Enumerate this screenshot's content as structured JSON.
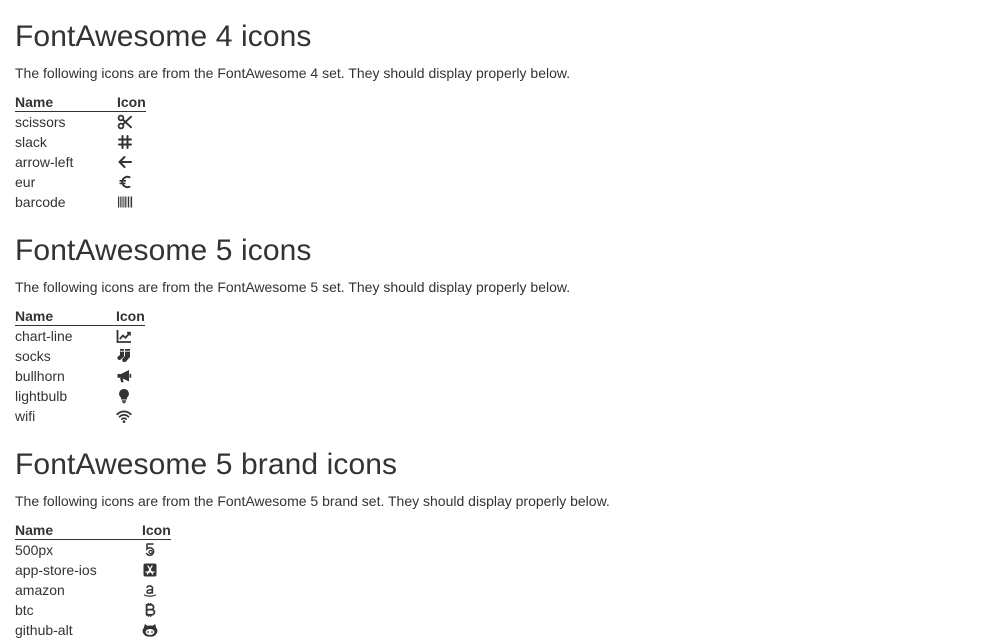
{
  "sections": [
    {
      "title": "FontAwesome 4 icons",
      "description": "The following icons are from the FontAwesome 4 set. They should display properly below.",
      "headers": {
        "name": "Name",
        "icon": "Icon"
      },
      "rows": [
        {
          "name": "scissors",
          "icon": "scissors-icon"
        },
        {
          "name": "slack",
          "icon": "slack-icon"
        },
        {
          "name": "arrow-left",
          "icon": "arrow-left-icon"
        },
        {
          "name": "eur",
          "icon": "eur-icon"
        },
        {
          "name": "barcode",
          "icon": "barcode-icon"
        }
      ]
    },
    {
      "title": "FontAwesome 5 icons",
      "description": "The following icons are from the FontAwesome 5 set. They should display properly below.",
      "headers": {
        "name": "Name",
        "icon": "Icon"
      },
      "rows": [
        {
          "name": "chart-line",
          "icon": "chart-line-icon"
        },
        {
          "name": "socks",
          "icon": "socks-icon"
        },
        {
          "name": "bullhorn",
          "icon": "bullhorn-icon"
        },
        {
          "name": "lightbulb",
          "icon": "lightbulb-icon"
        },
        {
          "name": "wifi",
          "icon": "wifi-icon"
        }
      ]
    },
    {
      "title": "FontAwesome 5 brand icons",
      "description": "The following icons are from the FontAwesome 5 brand set. They should display properly below.",
      "headers": {
        "name": "Name",
        "icon": "Icon"
      },
      "rows": [
        {
          "name": "500px",
          "icon": "500px-icon"
        },
        {
          "name": "app-store-ios",
          "icon": "app-store-ios-icon"
        },
        {
          "name": "amazon",
          "icon": "amazon-icon"
        },
        {
          "name": "btc",
          "icon": "btc-icon"
        },
        {
          "name": "github-alt",
          "icon": "github-alt-icon"
        }
      ]
    }
  ]
}
